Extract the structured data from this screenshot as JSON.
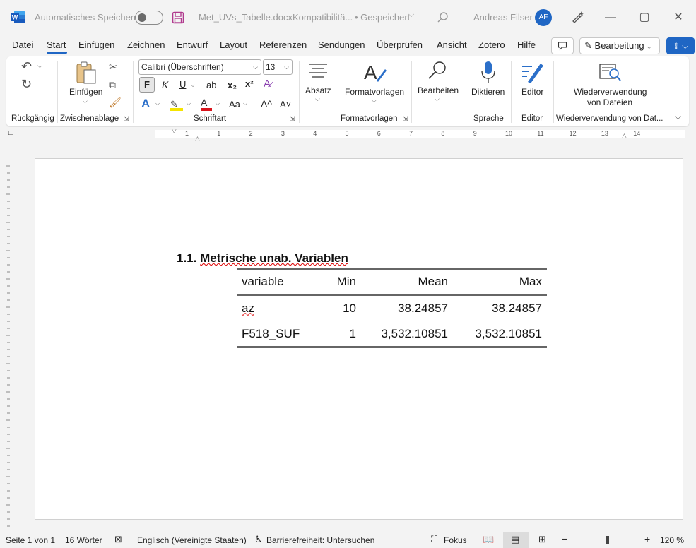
{
  "titlebar": {
    "autosave_label": "Automatisches Speichern",
    "document_title": "Met_UVs_Tabelle.docx",
    "compat": "Kompatibilitä...",
    "saved": "• Gespeichert",
    "user_name": "Andreas Filser",
    "avatar_initials": "AF"
  },
  "menu": {
    "tabs": [
      "Datei",
      "Start",
      "Einfügen",
      "Zeichnen",
      "Entwurf",
      "Layout",
      "Referenzen",
      "Sendungen",
      "Überprüfen",
      "Ansicht",
      "Zotero",
      "Hilfe"
    ],
    "active": "Start",
    "edit_mode": "Bearbeitung"
  },
  "ribbon": {
    "clipboard": {
      "paste_label": "Einfügen",
      "group": "Zwischenablage"
    },
    "undo_group": "Rückgängig",
    "font": {
      "name": "Calibri (Überschriften)",
      "size": "13",
      "bold": "F",
      "italic": "K",
      "underline": "U",
      "strike": "ab",
      "subscript": "x₂",
      "superscript": "x²",
      "case": "Aa",
      "grow": "A^",
      "shrink": "A˅",
      "group": "Schriftart"
    },
    "paragraph": {
      "label": "Absatz"
    },
    "styles": {
      "label": "Formatvorlagen",
      "group": "Formatvorlagen"
    },
    "editing": {
      "label": "Bearbeiten"
    },
    "dictate": {
      "label": "Diktieren",
      "group": "Sprache"
    },
    "editor": {
      "label": "Editor",
      "group": "Editor"
    },
    "reuse": {
      "label_line1": "Wiederverwendung",
      "label_line2": "von Dateien",
      "group": "Wiederverwendung von Dat..."
    }
  },
  "ruler": {
    "numbers": [
      "1",
      "1",
      "2",
      "3",
      "4",
      "5",
      "6",
      "7",
      "8",
      "9",
      "10",
      "11",
      "12",
      "13",
      "14"
    ]
  },
  "document": {
    "heading_number": "1.1.",
    "heading_text": "Metrische unab. Variablen",
    "table": {
      "headers": [
        "variable",
        "Min",
        "Mean",
        "Max"
      ],
      "rows": [
        [
          "az",
          "10",
          "38.24857",
          "38.24857"
        ],
        [
          "F518_SUF",
          "1",
          "3,532.10851",
          "3,532.10851"
        ]
      ]
    }
  },
  "status": {
    "page": "Seite 1 von 1",
    "words": "16 Wörter",
    "language": "Englisch (Vereinigte Staaten)",
    "accessibility": "Barrierefreiheit: Untersuchen",
    "focus": "Fokus",
    "zoom": "120 %"
  },
  "colors": {
    "accent": "#1f66c4",
    "squiggle": "#dd0000"
  }
}
